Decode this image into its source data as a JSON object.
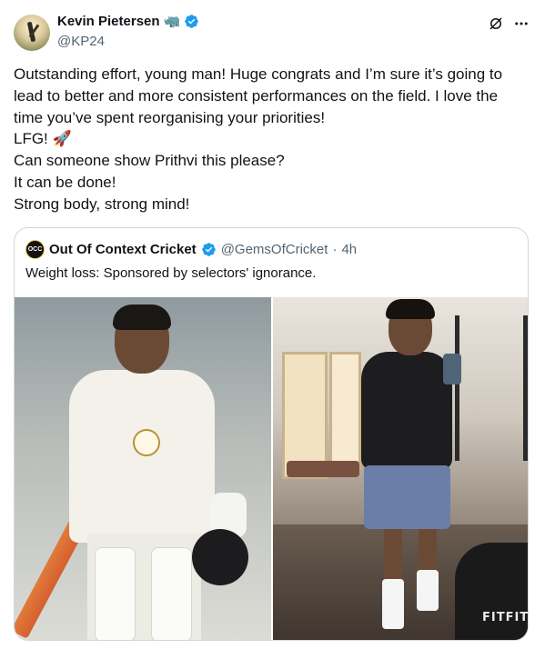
{
  "author": {
    "name": "Kevin Pietersen",
    "name_emoji": "🦏",
    "handle": "@KP24"
  },
  "icons": {
    "verified": "verified-badge-icon",
    "grok": "grok-icon",
    "more": "more-options-icon"
  },
  "colors": {
    "verified_blue": "#1d9bf0",
    "secondary_text": "#536471"
  },
  "tweet": {
    "lines": [
      "Outstanding effort, young man! Huge congrats and I’m sure it’s going to",
      "lead to better and more consistent performances on the field. I love the",
      "time you’ve spent reorganising your priorities!",
      "LFG! 🚀",
      "Can someone show Prithvi this please?",
      "It can be done!",
      "Strong body, strong mind!"
    ]
  },
  "quoted_tweet": {
    "avatar_text": "OCC",
    "name": "Out Of Context Cricket",
    "handle": "@GemsOfCricket",
    "separator": "·",
    "time": "4h",
    "text": "Weight loss: Sponsored by selectors' ignorance.",
    "media": {
      "left_photo": "cricketer-celebrating-photo",
      "right_photo": "gym-mirror-selfie-photo",
      "gym_brand_text": "FITFIT"
    }
  }
}
